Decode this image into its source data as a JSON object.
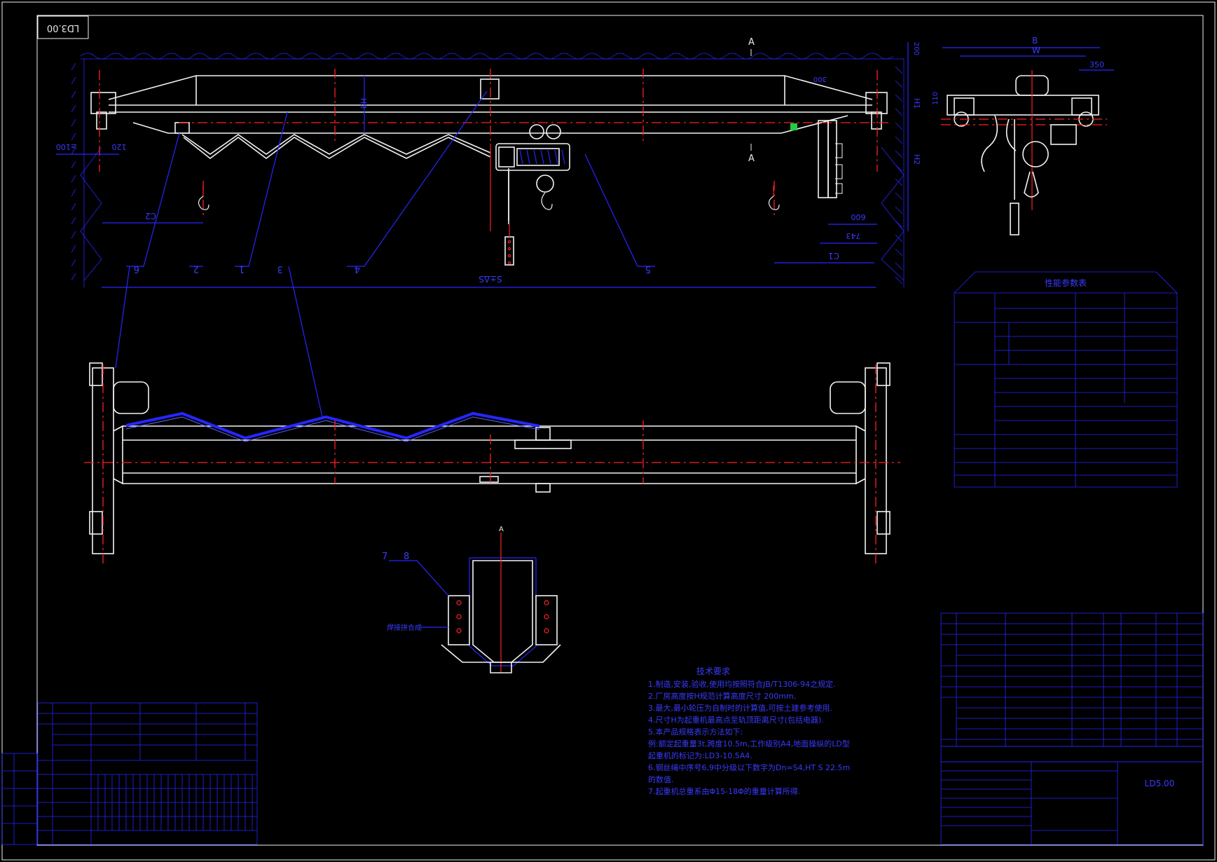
{
  "drawing_number": "LD3.00",
  "drawing_number_short": "LD5.00",
  "section_label": "A",
  "section_label_top": "A",
  "section_label_bottom": "A",
  "dimensions": {
    "span": "S±ΔS",
    "c1": "C1",
    "c2": "C2",
    "d600": "600",
    "d743": "743",
    "d100": "≥100",
    "d120": "120",
    "d350": "350",
    "d200": "200",
    "d300": "300",
    "d110": "110",
    "b": "B",
    "w": "W",
    "h1": "H1",
    "h2": "H2",
    "h3": "H3"
  },
  "part_callouts": [
    "6",
    "2",
    "1",
    "3",
    "4",
    "5",
    "7",
    "8"
  ],
  "tech_requirements": {
    "title": "技术要求",
    "items": [
      "1.制造,安装,验收,使用均按照符合JB/T1306-94之规定.",
      "2.厂房高度按H规范计算高度尺寸 200mm.",
      "3.最大,最小轮压为自制时的计算值,可按土建参考使用.",
      "4.尺寸H为起重机最高点至轨顶距离尺寸(包括电器).",
      "5.本产品规格表示方法如下:",
      "例:额定起重量3t,跨度10.5m,工作级别A4,地面操纵的LD型",
      "起重机的标记为:LD3-10.5A4.",
      "6.钢丝绳中序号6,9中分级以下数字为Dn=S4,HT S 22.5m",
      "的数值.",
      "7.起重机总重系由Φ15-18Φ的重量计算所得."
    ]
  },
  "perf_table_title": "性能参数表",
  "section_note": "焊接拼合成"
}
